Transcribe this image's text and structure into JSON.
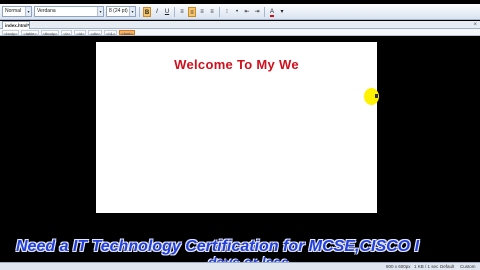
{
  "toolbar": {
    "style_value": "Normal",
    "font_value": "Verdana",
    "size_value": "8 (24 pt)",
    "bold_label": "B",
    "italic_label": "I",
    "underline_label": "U"
  },
  "document_tab": {
    "label": "index.html*",
    "close_glyph": "×"
  },
  "tag_selector": {
    "tags": [
      "<body>",
      "<table>",
      "<tbody>",
      "<tr>",
      "<td>",
      "<div>",
      "<h1>",
      "<font>"
    ],
    "selected_index": 7
  },
  "page": {
    "heading": "Welcome To My We"
  },
  "banner": {
    "line1": "Need a IT Technology Certification for MCSE,CISCO I",
    "line2": "days or less"
  },
  "statusbar": {
    "dimensions": "800 x 600px",
    "size_time": "1 KB / 1 sec",
    "mode": "Default",
    "view": "Custom"
  },
  "colors": {
    "heading": "#d0101c",
    "banner_text": "#2040d8",
    "cursor_highlight": "#fff200"
  }
}
